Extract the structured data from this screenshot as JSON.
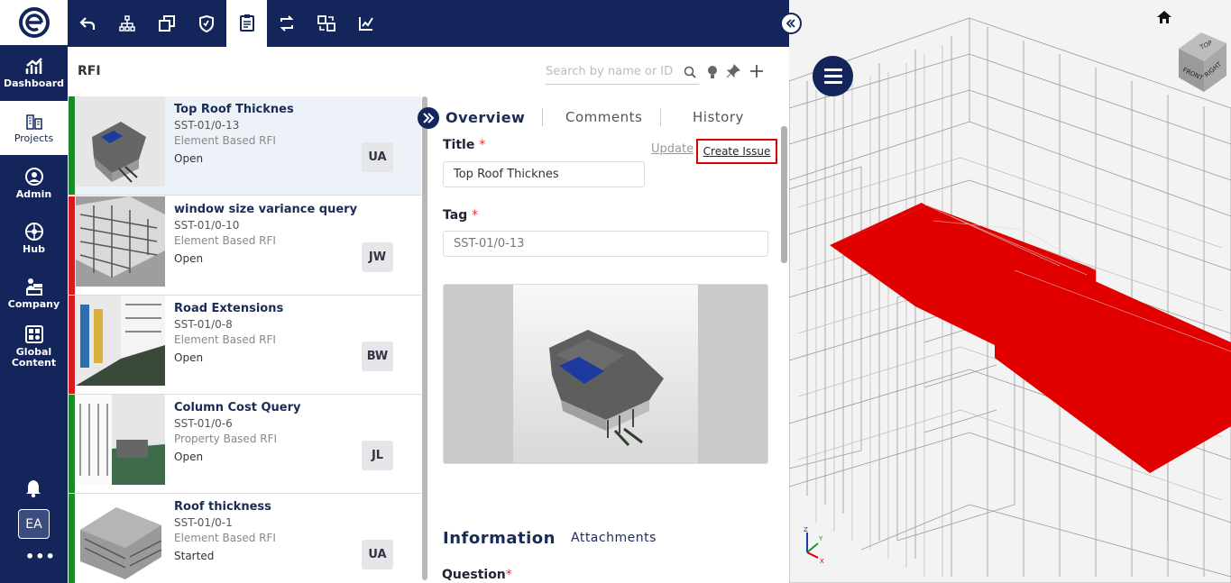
{
  "nav": {
    "items": [
      {
        "label": "Dashboard",
        "icon": "chart-icon"
      },
      {
        "label": "Projects",
        "icon": "buildings-icon"
      },
      {
        "label": "Admin",
        "icon": "admin-icon"
      },
      {
        "label": "Hub",
        "icon": "hub-icon"
      },
      {
        "label": "Company",
        "icon": "company-icon"
      },
      {
        "label": "Global Content",
        "icon": "global-content-icon"
      }
    ],
    "avatar": "EA",
    "more": "•••"
  },
  "toolbar": {
    "icons": [
      "undo-icon",
      "hierarchy-icon",
      "copy-icon",
      "shield-icon",
      "clipboard-icon",
      "sync-icon",
      "transfer-icon",
      "check-chart-icon"
    ],
    "active": "clipboard-icon"
  },
  "rfi": {
    "title": "RFI",
    "search_placeholder": "Search by name or ID"
  },
  "list": [
    {
      "title": "Top Roof Thicknes",
      "id": "SST-01/0-13",
      "type": "Element Based RFI",
      "status": "Open",
      "assignee": "UA",
      "color": "#1a8a2a",
      "selected": true
    },
    {
      "title": "window size variance query",
      "id": "SST-01/0-10",
      "type": "Element Based RFI",
      "status": "Open",
      "assignee": "JW",
      "color": "#d71920",
      "selected": false
    },
    {
      "title": "Road Extensions",
      "id": "SST-01/0-8",
      "type": "Element Based RFI",
      "status": "Open",
      "assignee": "BW",
      "color": "#d71920",
      "selected": false
    },
    {
      "title": "Column Cost Query",
      "id": "SST-01/0-6",
      "type": "Property Based RFI",
      "status": "Open",
      "assignee": "JL",
      "color": "#1a8a2a",
      "selected": false
    },
    {
      "title": "Roof thickness",
      "id": "SST-01/0-1",
      "type": "Element Based RFI",
      "status": "Started",
      "assignee": "UA",
      "color": "#1a8a2a",
      "selected": false
    }
  ],
  "detail": {
    "tabs": [
      "Overview",
      "Comments",
      "History"
    ],
    "title_label": "Title",
    "title_value": "Top Roof Thicknes",
    "update_label": "Update",
    "create_issue_label": "Create Issue",
    "tag_label": "Tag",
    "tag_value": "SST-01/0-13",
    "required_mark": "*",
    "section_information": "Information",
    "section_attachments": "Attachments",
    "question_label": "Question"
  },
  "colors": {
    "navy": "#13255a",
    "highlight": "#e00000",
    "roof_red": "#e00000",
    "status_open": "#1a8a2a",
    "status_red": "#d71920"
  },
  "viewer": {
    "cube_faces": [
      "TOP",
      "FRONT",
      "RIGHT"
    ],
    "axes": [
      "Z",
      "Y",
      "X"
    ]
  }
}
